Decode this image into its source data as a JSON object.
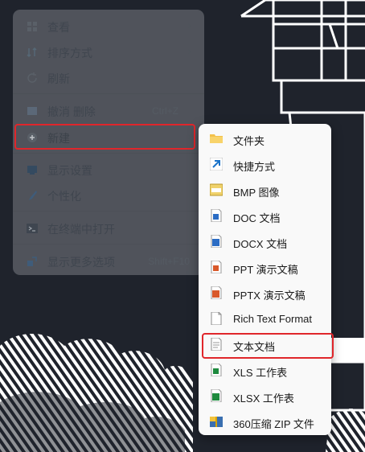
{
  "context_menu": {
    "items": [
      {
        "label": "查看",
        "icon": "grid-icon",
        "has_submenu": true
      },
      {
        "label": "排序方式",
        "icon": "sort-icon",
        "has_submenu": true
      },
      {
        "label": "刷新",
        "icon": "refresh-icon",
        "has_submenu": false
      },
      {
        "label": "撤消 删除",
        "icon": "undo-icon",
        "shortcut": "Ctrl+Z"
      },
      {
        "label": "新建",
        "icon": "add-circle-icon",
        "has_submenu": true,
        "highlighted": true
      },
      {
        "label": "显示设置",
        "icon": "display-icon"
      },
      {
        "label": "个性化",
        "icon": "brush-icon"
      },
      {
        "label": "在终端中打开",
        "icon": "terminal-icon"
      },
      {
        "label": "显示更多选项",
        "icon": "more-options-icon",
        "shortcut": "Shift+F10"
      }
    ],
    "chevron": "›"
  },
  "new_submenu": {
    "items": [
      {
        "label": "文件夹",
        "icon": "folder-icon"
      },
      {
        "label": "快捷方式",
        "icon": "shortcut-icon"
      },
      {
        "label": "BMP 图像",
        "icon": "bmp-file-icon"
      },
      {
        "label": "DOC 文档",
        "icon": "doc-file-icon"
      },
      {
        "label": "DOCX 文档",
        "icon": "docx-file-icon"
      },
      {
        "label": "PPT 演示文稿",
        "icon": "ppt-file-icon"
      },
      {
        "label": "PPTX 演示文稿",
        "icon": "pptx-file-icon"
      },
      {
        "label": "Rich Text Format",
        "icon": "rtf-file-icon"
      },
      {
        "label": "文本文档",
        "icon": "txt-file-icon",
        "highlighted": true
      },
      {
        "label": "XLS 工作表",
        "icon": "xls-file-icon"
      },
      {
        "label": "XLSX 工作表",
        "icon": "xlsx-file-icon"
      },
      {
        "label": "360压缩 ZIP 文件",
        "icon": "zip-archive-icon"
      }
    ]
  },
  "colors": {
    "highlight_border": "#e0262b",
    "desktop_bg": "#1f232c",
    "submenu_bg": "#f9f9f9"
  }
}
